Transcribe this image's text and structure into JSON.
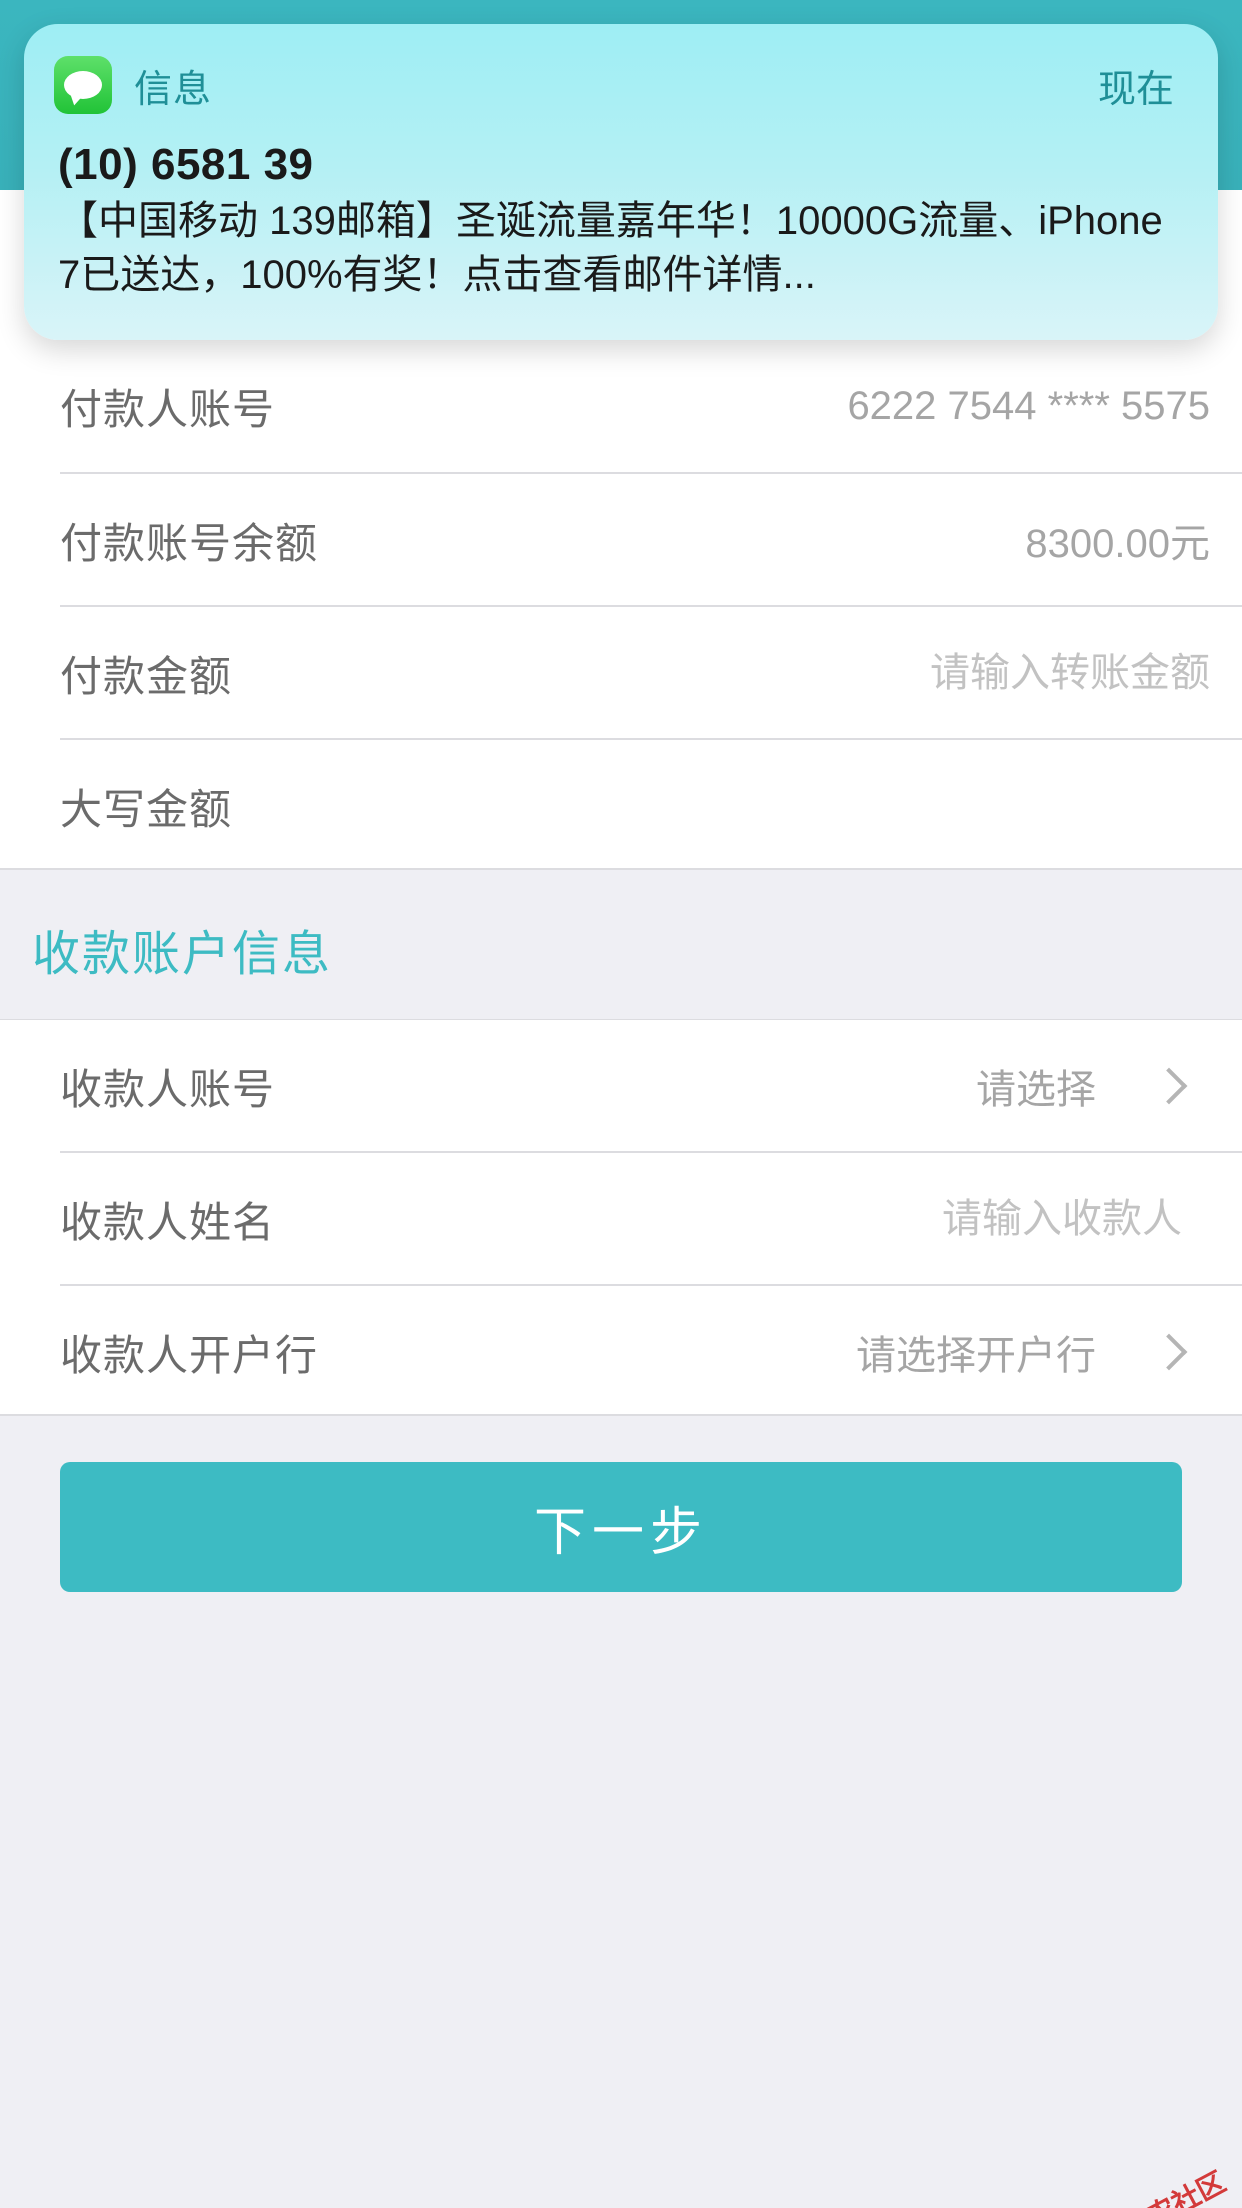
{
  "notification": {
    "app_name": "信息",
    "time": "现在",
    "sender": "(10) 6581 39",
    "body": "【中国移动 139邮箱】圣诞流量嘉年华！10000G流量、iPhone 7已送达，100%有奖！点击查看邮件详情...",
    "icon": "messages-icon"
  },
  "payer_section": {
    "rows": [
      {
        "label": "付款人账号",
        "value": "6222 7544 **** 5575"
      },
      {
        "label": "付款账号余额",
        "value": "8300.00元"
      },
      {
        "label": "付款金额",
        "placeholder": "请输入转账金额"
      },
      {
        "label": "大写金额",
        "value": ""
      }
    ]
  },
  "payee_section": {
    "title": "收款账户信息",
    "rows": [
      {
        "label": "收款人账号",
        "value": "请选择"
      },
      {
        "label": "收款人姓名",
        "placeholder": "请输入收款人"
      },
      {
        "label": "收款人开户行",
        "value": "请选择开户行"
      }
    ]
  },
  "actions": {
    "next_label": "下一步"
  },
  "watermark": {
    "text": "卡农社区"
  },
  "colors": {
    "accent": "#3dbbc3",
    "background": "#efeff4"
  }
}
